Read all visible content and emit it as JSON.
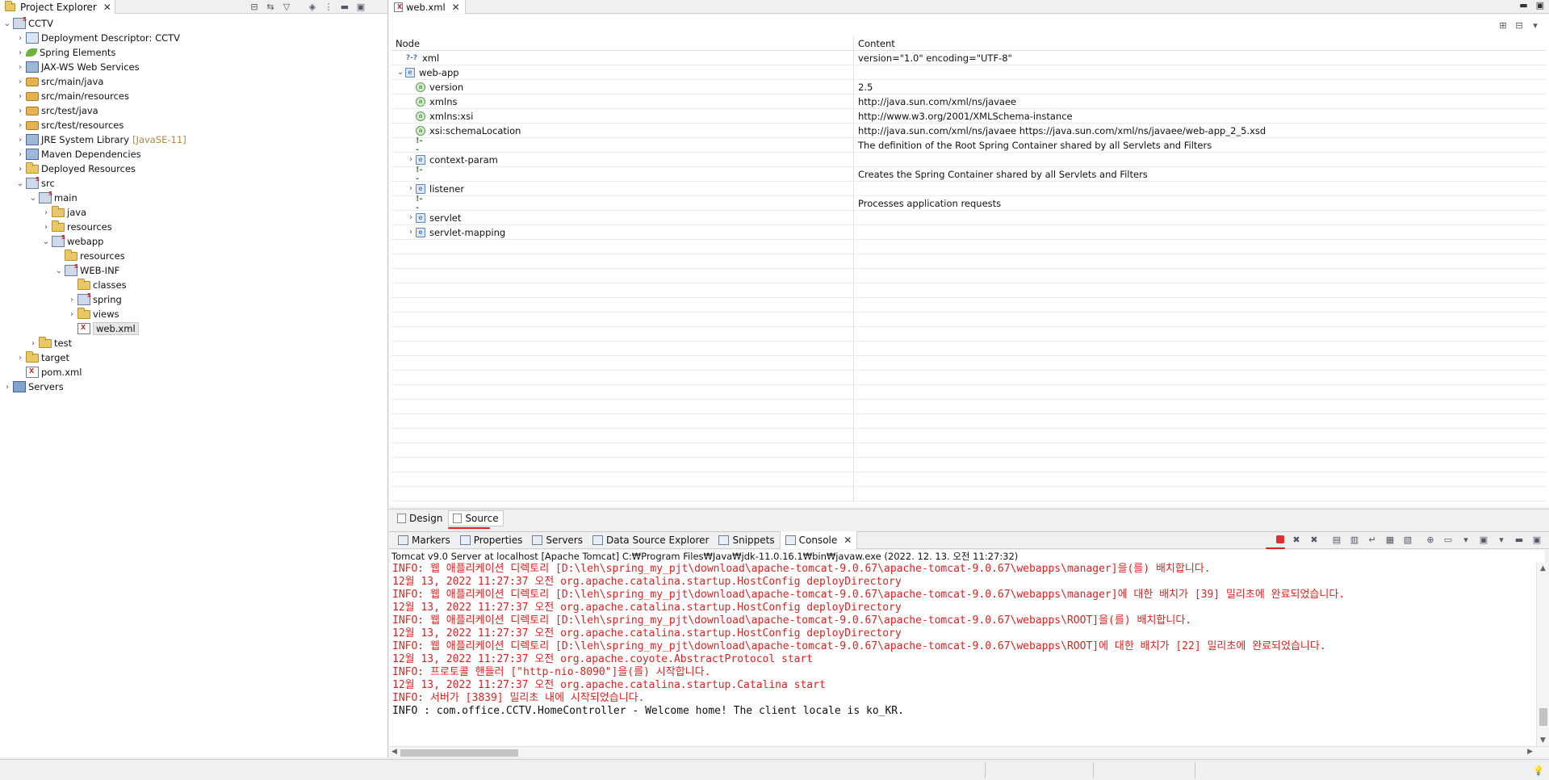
{
  "left_panel": {
    "tab_label": "Project Explorer",
    "tree": [
      {
        "label": "CCTV",
        "depth": 0,
        "chevron": "v",
        "icon": "proj"
      },
      {
        "label": "Deployment Descriptor: CCTV",
        "depth": 1,
        "chevron": ">",
        "icon": "dd"
      },
      {
        "label": "Spring Elements",
        "depth": 1,
        "chevron": ">",
        "icon": "spring"
      },
      {
        "label": "JAX-WS Web Services",
        "depth": 1,
        "chevron": ">",
        "icon": "lib"
      },
      {
        "label": "src/main/java",
        "depth": 1,
        "chevron": ">",
        "icon": "pkg"
      },
      {
        "label": "src/main/resources",
        "depth": 1,
        "chevron": ">",
        "icon": "pkg"
      },
      {
        "label": "src/test/java",
        "depth": 1,
        "chevron": ">",
        "icon": "pkg"
      },
      {
        "label": "src/test/resources",
        "depth": 1,
        "chevron": ">",
        "icon": "pkg"
      },
      {
        "label": "JRE System Library",
        "deco": "[JavaSE-11]",
        "depth": 1,
        "chevron": ">",
        "icon": "lib"
      },
      {
        "label": "Maven Dependencies",
        "depth": 1,
        "chevron": ">",
        "icon": "lib"
      },
      {
        "label": "Deployed Resources",
        "depth": 1,
        "chevron": ">",
        "icon": "folder"
      },
      {
        "label": "src",
        "depth": 1,
        "chevron": "v",
        "icon": "proj"
      },
      {
        "label": "main",
        "depth": 2,
        "chevron": "v",
        "icon": "proj"
      },
      {
        "label": "java",
        "depth": 3,
        "chevron": ">",
        "icon": "folder"
      },
      {
        "label": "resources",
        "depth": 3,
        "chevron": ">",
        "icon": "folder"
      },
      {
        "label": "webapp",
        "depth": 3,
        "chevron": "v",
        "icon": "proj"
      },
      {
        "label": "resources",
        "depth": 4,
        "chevron": "",
        "icon": "folder"
      },
      {
        "label": "WEB-INF",
        "depth": 4,
        "chevron": "v",
        "icon": "proj"
      },
      {
        "label": "classes",
        "depth": 5,
        "chevron": "",
        "icon": "folder"
      },
      {
        "label": "spring",
        "depth": 5,
        "chevron": ">",
        "icon": "proj"
      },
      {
        "label": "views",
        "depth": 5,
        "chevron": ">",
        "icon": "folder"
      },
      {
        "label": "web.xml",
        "depth": 5,
        "chevron": "",
        "icon": "xmlfile",
        "selected": true
      },
      {
        "label": "test",
        "depth": 2,
        "chevron": ">",
        "icon": "folder"
      },
      {
        "label": "target",
        "depth": 1,
        "chevron": ">",
        "icon": "folder"
      },
      {
        "label": "pom.xml",
        "depth": 1,
        "chevron": "",
        "icon": "xmlfile"
      },
      {
        "label": "Servers",
        "depth": 0,
        "chevron": ">",
        "icon": "servers"
      }
    ]
  },
  "editor": {
    "tab_label": "web.xml",
    "columns": {
      "node": "Node",
      "content": "Content"
    },
    "rows": [
      {
        "badge": "?-?",
        "kind": "pi",
        "indent": 0,
        "chevron": "",
        "node": "xml",
        "content": "version=\"1.0\" encoding=\"UTF-8\""
      },
      {
        "badge": "e",
        "kind": "e",
        "indent": 0,
        "chevron": "v",
        "node": "web-app",
        "content": ""
      },
      {
        "badge": "a",
        "kind": "at",
        "indent": 1,
        "chevron": "",
        "node": "version",
        "content": "2.5"
      },
      {
        "badge": "a",
        "kind": "at",
        "indent": 1,
        "chevron": "",
        "node": "xmlns",
        "content": "http://java.sun.com/xml/ns/javaee"
      },
      {
        "badge": "a",
        "kind": "at",
        "indent": 1,
        "chevron": "",
        "node": "xmlns:xsi",
        "content": "http://www.w3.org/2001/XMLSchema-instance"
      },
      {
        "badge": "a",
        "kind": "at",
        "indent": 1,
        "chevron": "",
        "node": "xsi:schemaLocation",
        "content": "http://java.sun.com/xml/ns/javaee https://java.sun.com/xml/ns/javaee/web-app_2_5.xsd"
      },
      {
        "badge": "!--",
        "kind": "cm",
        "indent": 1,
        "chevron": "",
        "node": "",
        "content": " The definition of the Root Spring Container shared by all Servlets and Filters"
      },
      {
        "badge": "e",
        "kind": "e",
        "indent": 1,
        "chevron": ">",
        "node": "context-param",
        "content": ""
      },
      {
        "badge": "!--",
        "kind": "cm",
        "indent": 1,
        "chevron": "",
        "node": "",
        "content": " Creates the Spring Container shared by all Servlets and Filters"
      },
      {
        "badge": "e",
        "kind": "e",
        "indent": 1,
        "chevron": ">",
        "node": "listener",
        "content": ""
      },
      {
        "badge": "!--",
        "kind": "cm",
        "indent": 1,
        "chevron": "",
        "node": "",
        "content": " Processes application requests"
      },
      {
        "badge": "e",
        "kind": "e",
        "indent": 1,
        "chevron": ">",
        "node": "servlet",
        "content": ""
      },
      {
        "badge": "e",
        "kind": "e",
        "indent": 1,
        "chevron": ">",
        "node": "servlet-mapping",
        "content": ""
      }
    ],
    "empty_rows": 18,
    "bottom_tabs": {
      "design": "Design",
      "source": "Source"
    }
  },
  "console_panel": {
    "tabs": [
      "Markers",
      "Properties",
      "Servers",
      "Data Source Explorer",
      "Snippets",
      "Console"
    ],
    "active_tab": "Console",
    "description": "Tomcat v9.0 Server at localhost [Apache Tomcat] C:₩Program Files₩Java₩jdk-11.0.16.1₩bin₩javaw.exe  (2022. 12. 13. 오전 11:27:32)",
    "lines": [
      {
        "text": "INFO: 웹 애플리케이션 디렉토리 [D:\\leh\\spring_my_pjt\\download\\apache-tomcat-9.0.67\\apache-tomcat-9.0.67\\webapps\\manager]을(를) 배치합니다.",
        "stream": "err"
      },
      {
        "text": "12월 13, 2022 11:27:37 오전 org.apache.catalina.startup.HostConfig deployDirectory",
        "stream": "err"
      },
      {
        "text": "INFO: 웹 애플리케이션 디렉토리 [D:\\leh\\spring_my_pjt\\download\\apache-tomcat-9.0.67\\apache-tomcat-9.0.67\\webapps\\manager]에 대한 배치가 [39] 밀리초에 완료되었습니다.",
        "stream": "err"
      },
      {
        "text": "12월 13, 2022 11:27:37 오전 org.apache.catalina.startup.HostConfig deployDirectory",
        "stream": "err"
      },
      {
        "text": "INFO: 웹 애플리케이션 디렉토리 [D:\\leh\\spring_my_pjt\\download\\apache-tomcat-9.0.67\\apache-tomcat-9.0.67\\webapps\\ROOT]을(를) 배치합니다.",
        "stream": "err"
      },
      {
        "text": "12월 13, 2022 11:27:37 오전 org.apache.catalina.startup.HostConfig deployDirectory",
        "stream": "err"
      },
      {
        "text": "INFO: 웹 애플리케이션 디렉토리 [D:\\leh\\spring_my_pjt\\download\\apache-tomcat-9.0.67\\apache-tomcat-9.0.67\\webapps\\ROOT]에 대한 배치가 [22] 밀리초에 완료되었습니다.",
        "stream": "err"
      },
      {
        "text": "12월 13, 2022 11:27:37 오전 org.apache.coyote.AbstractProtocol start",
        "stream": "err"
      },
      {
        "text": "INFO: 프로토콜 핸들러 [\"http-nio-8090\"]을(를) 시작합니다.",
        "stream": "err"
      },
      {
        "text": "12월 13, 2022 11:27:37 오전 org.apache.catalina.startup.Catalina start",
        "stream": "err"
      },
      {
        "text": "INFO: 서버가 [3839] 밀리초 내에 시작되었습니다.",
        "stream": "err"
      },
      {
        "text": "INFO : com.office.CCTV.HomeController - Welcome home! The client locale is ko_KR.",
        "stream": "out"
      }
    ]
  },
  "colors": {
    "stderr": "#e02020",
    "accent_underline": "#e02020"
  }
}
